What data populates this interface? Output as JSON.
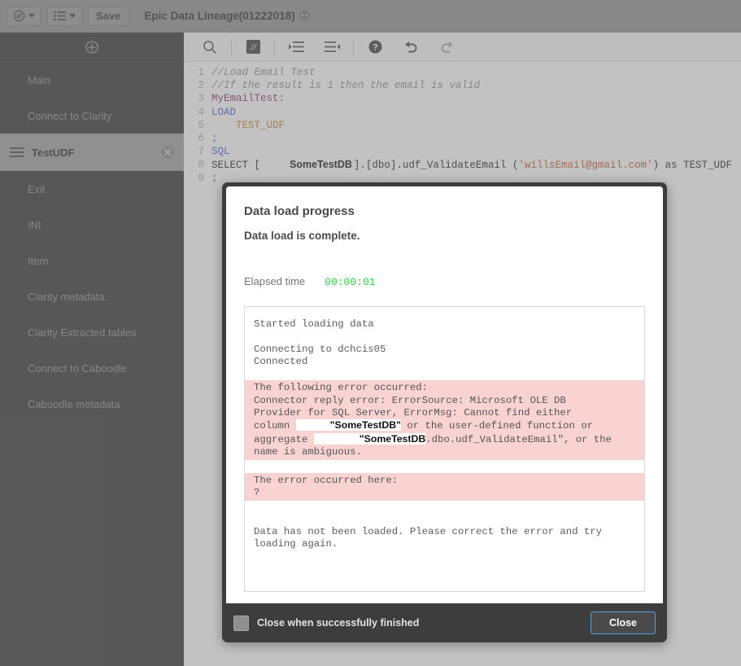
{
  "topbar": {
    "nav_button_icon": "compass-icon",
    "list_button_icon": "list-icon",
    "save_label": "Save",
    "doc_title": "Epic Data Lineage(01222018)"
  },
  "sidebar": {
    "add_icon": "plus-circle-icon",
    "items": [
      {
        "label": "Main",
        "active": false
      },
      {
        "label": "Connect to Clarity",
        "active": false
      },
      {
        "label": "TestUDF",
        "active": true
      },
      {
        "label": "Exit",
        "active": false
      },
      {
        "label": "INI",
        "active": false
      },
      {
        "label": "Item",
        "active": false
      },
      {
        "label": "Clarity metadata",
        "active": false
      },
      {
        "label": "Clarity Extracted tables",
        "active": false
      },
      {
        "label": "Connect to Caboodle",
        "active": false
      },
      {
        "label": "Caboodle metadata",
        "active": false
      }
    ]
  },
  "editor": {
    "toolbar": [
      {
        "name": "search-icon"
      },
      {
        "name": "comment-icon"
      },
      {
        "name": "indent-increase-icon"
      },
      {
        "name": "indent-decrease-icon"
      },
      {
        "name": "help-icon"
      },
      {
        "name": "undo-icon"
      },
      {
        "name": "redo-icon"
      }
    ],
    "lines": [
      {
        "n": "1",
        "text": "//Load Email Test"
      },
      {
        "n": "2",
        "text": "//If the result is 1 then the email is valid"
      },
      {
        "n": "3",
        "text": "MyEmailTest:"
      },
      {
        "n": "4",
        "text": "LOAD"
      },
      {
        "n": "5",
        "text": "    TEST_UDF"
      },
      {
        "n": "6",
        "text": ";"
      },
      {
        "n": "7",
        "text": "SQL"
      },
      {
        "n": "8",
        "text": "SELECT [SomeTestDB].[dbo].udf_ValidateEmail ('willsEmail@gmail.com') as TEST_UDF"
      },
      {
        "n": "9",
        "text": ";"
      }
    ],
    "l8": {
      "pre": "SELECT [",
      "redacted": "SomeTestDB",
      "mid": "].[dbo].udf_ValidateEmail (",
      "str": "'willsEmail@gmail.com'",
      "post": ") as TEST_UDF"
    }
  },
  "dialog": {
    "title": "Data load progress",
    "subtitle": "Data load is complete.",
    "elapsed_label": "Elapsed time",
    "elapsed_value": "00:00:01",
    "log": {
      "started": "Started loading data",
      "connecting": "Connecting to dchcis05",
      "connected": "Connected",
      "err_head": "The following error occurred:",
      "err_l1": "Connector reply error: ErrorSource: Microsoft OLE DB",
      "err_l2": "Provider for SQL Server, ErrorMsg: Cannot find either",
      "err_l3_a": "column ",
      "err_l3_redact": "\"SomeTestDB\"",
      "err_l3_b": " or the user-defined function or",
      "err_l4_a": "aggregate ",
      "err_l4_redact": "\"SomeTestDB",
      "err_l4_b": ".dbo.udf_ValidateEmail\", or the",
      "err_l5": "name is ambiguous.",
      "err_here": "The error occurred here:",
      "err_here_val": "?",
      "tail_l1": "Data has not been loaded. Please correct the error and try",
      "tail_l2": "loading again."
    },
    "checkbox_label": "Close when successfully finished",
    "close_label": "Close"
  },
  "colors": {
    "accent_green": "#2ecc40",
    "error_bg": "#f9d2d2",
    "focus_blue": "#4fa3e3",
    "sidebar_bg": "#333333"
  }
}
